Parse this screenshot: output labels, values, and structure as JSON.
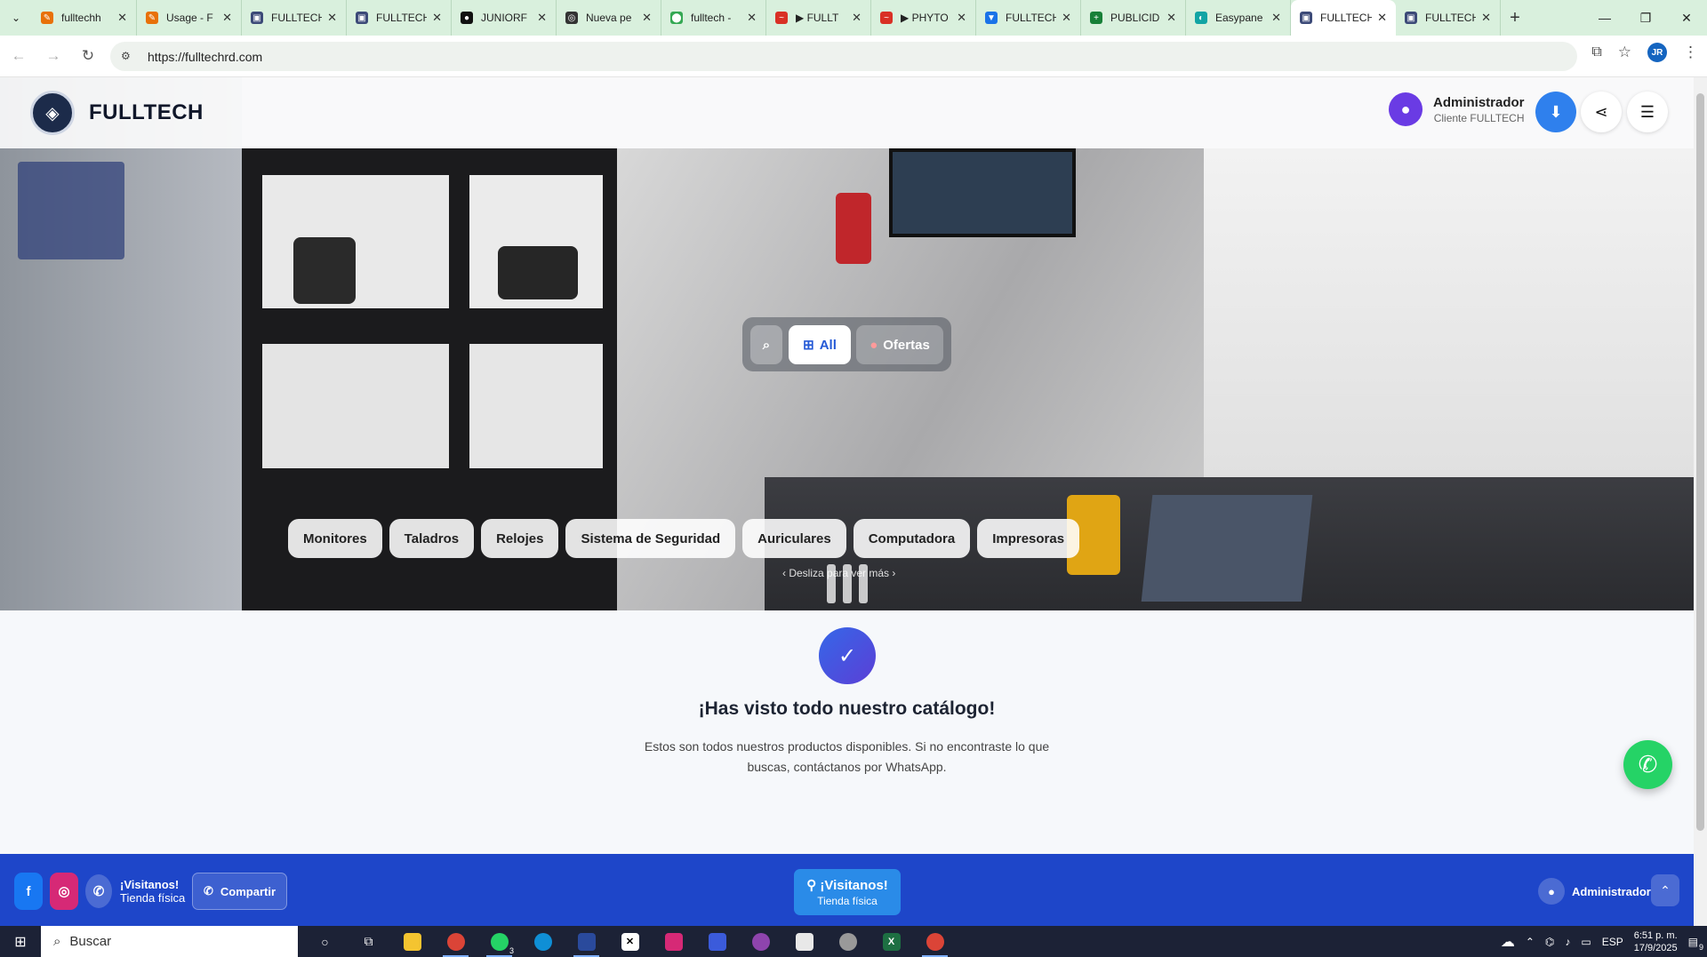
{
  "browser": {
    "tabs": [
      {
        "title": "fulltechh",
        "color": "#e8710a",
        "glyph": "✎",
        "active": false
      },
      {
        "title": "Usage - F",
        "color": "#e8710a",
        "glyph": "✎",
        "active": false
      },
      {
        "title": "FULLTECH",
        "color": "#3c4a78",
        "glyph": "▣",
        "active": false
      },
      {
        "title": "FULLTECH",
        "color": "#3c4a78",
        "glyph": "▣",
        "active": false
      },
      {
        "title": "JUNIORF",
        "color": "#111111",
        "glyph": "●",
        "active": false
      },
      {
        "title": "Nueva pe",
        "color": "#333333",
        "glyph": "◎",
        "active": false
      },
      {
        "title": "fulltech -",
        "color": "#34a853",
        "glyph": "⬤",
        "active": false
      },
      {
        "title": "▶ FULLT",
        "color": "#d93025",
        "glyph": "~",
        "active": false
      },
      {
        "title": "▶ PHYTO",
        "color": "#d93025",
        "glyph": "~",
        "active": false
      },
      {
        "title": "FULLTECH",
        "color": "#1a73e8",
        "glyph": "▼",
        "active": false
      },
      {
        "title": "PUBLICID",
        "color": "#188038",
        "glyph": "+",
        "active": false
      },
      {
        "title": "Easypane",
        "color": "#12a4a4",
        "glyph": "◐",
        "active": false
      },
      {
        "title": "FULLTECH",
        "color": "#3c4a78",
        "glyph": "▣",
        "active": true
      },
      {
        "title": "FULLTECH",
        "color": "#3c4a78",
        "glyph": "▣",
        "active": false
      }
    ],
    "url": "https://fulltechrd.com",
    "profile_initials": "JR"
  },
  "header": {
    "brand": "FULLTECH",
    "user_name": "Administrador",
    "user_role": "Cliente FULLTECH"
  },
  "search": {
    "all_label": "All",
    "offers_label": "Ofertas"
  },
  "categories": [
    "Monitores",
    "Taladros",
    "Relojes",
    "Sistema de Seguridad",
    "Auriculares",
    "Computadora",
    "Impresoras"
  ],
  "hero_hint": "Desliza para ver más",
  "end": {
    "title": "¡Has visto todo nuestro catálogo!",
    "text": "Estos son todos nuestros productos disponibles. Si no encontraste lo que buscas, contáctanos por WhatsApp."
  },
  "footer": {
    "visit_title": "¡Visitanos!",
    "visit_sub": "Tienda física",
    "share_label": "Compartir",
    "center_title": "¡Visitanos!",
    "center_sub": "Tienda física",
    "user_label": "Administrador"
  },
  "taskbar": {
    "search_placeholder": "Buscar",
    "language": "ESP",
    "time": "6:51 p. m.",
    "date": "17/9/2025",
    "whatsapp_badge": "3",
    "notif_count": "9"
  },
  "colors": {
    "accent_blue": "#1e46c9",
    "download_button": "#2f80ed",
    "whatsapp": "#25d366",
    "tabbar": "#d9f0dd"
  }
}
